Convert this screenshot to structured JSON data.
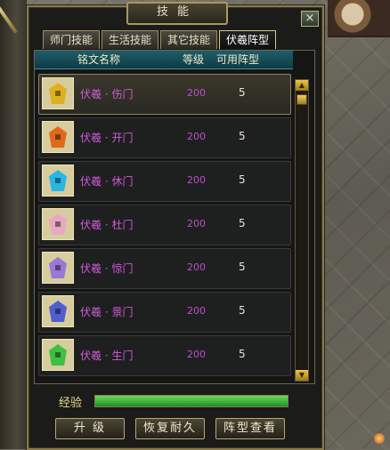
{
  "window": {
    "title": "技能",
    "close_label": "×"
  },
  "tabs": [
    {
      "label": "师门技能",
      "active": false
    },
    {
      "label": "生活技能",
      "active": false
    },
    {
      "label": "其它技能",
      "active": false
    },
    {
      "label": "伏羲阵型",
      "active": true
    }
  ],
  "list": {
    "headers": {
      "name": "铭文名称",
      "level": "等级",
      "formation": "可用阵型"
    },
    "rows": [
      {
        "name": "伏羲 · 伤门",
        "level": "200",
        "formation": "5",
        "gem_color": "#e0b020",
        "selected": true
      },
      {
        "name": "伏羲 · 开门",
        "level": "200",
        "formation": "5",
        "gem_color": "#e06a18",
        "selected": false
      },
      {
        "name": "伏羲 · 休门",
        "level": "200",
        "formation": "5",
        "gem_color": "#28b6e6",
        "selected": false
      },
      {
        "name": "伏羲 · 杜门",
        "level": "200",
        "formation": "5",
        "gem_color": "#e8a8c0",
        "selected": false
      },
      {
        "name": "伏羲 · 惊门",
        "level": "200",
        "formation": "5",
        "gem_color": "#9a78d8",
        "selected": false
      },
      {
        "name": "伏羲 · 景门",
        "level": "200",
        "formation": "5",
        "gem_color": "#4f5fd0",
        "selected": false
      },
      {
        "name": "伏羲 · 生门",
        "level": "200",
        "formation": "5",
        "gem_color": "#3cc040",
        "selected": false
      }
    ]
  },
  "experience": {
    "label": "经验",
    "progress": 1.0
  },
  "buttons": {
    "upgrade": "升 级",
    "restore": "恢复耐久",
    "view_formation": "阵型查看"
  },
  "colors": {
    "accent_gold": "#a99860",
    "name_purple": "#d05ad8",
    "header_teal": "#1d5e6a"
  }
}
